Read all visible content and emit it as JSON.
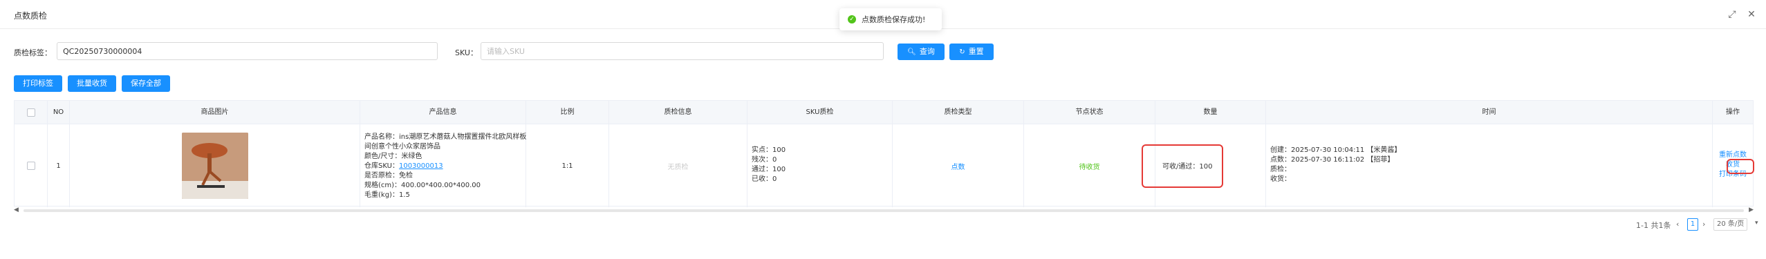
{
  "header": {
    "title": "点数质检"
  },
  "toast": {
    "message": "点数质检保存成功!"
  },
  "filters": {
    "tag_label": "质检标签：",
    "tag_value": "QC20250730000004",
    "sku_label": "SKU：",
    "sku_placeholder": "请输入SKU",
    "search_label": "查询",
    "reset_label": "重置"
  },
  "actions": {
    "print_label": "打印标签",
    "batch_receive": "批量收货",
    "save_all": "保存全部"
  },
  "table": {
    "headers": [
      "NO",
      "商品图片",
      "产品信息",
      "比例",
      "质检信息",
      "SKU质检",
      "质检类型",
      "节点状态",
      "数量",
      "时间",
      "操作"
    ],
    "row": {
      "no": "1",
      "product_info": {
        "name_line1": "产品名称：ins潮原艺术蘑菇人物摆置摆件北欧风样板",
        "name_line2": "间创意个性小众家居饰品",
        "color": "颜色/尺寸：米绿色",
        "sku_label": "仓库SKU：",
        "sku_link": "1003000013",
        "sourcing": "是否原检：免检",
        "size": "规格(cm)：400.00*400.00*400.00",
        "weight": "毛重(kg)：1.5"
      },
      "ratio": "1:1",
      "qc_info": "无质检",
      "sku_qc": {
        "actual": "实点：100",
        "defect": "残次：0",
        "pass": "通过：100",
        "received": "已收：0"
      },
      "qc_type": "点数",
      "node_status": "待收货",
      "quantity": "可收/通过：100",
      "time": {
        "created": "创建：2025-07-30 10:04:11 【米黄酱】",
        "counted": "点数：2025-07-30 16:11:02 【招菲】",
        "qc": "质检：",
        "received": "收货："
      },
      "ops": {
        "recount": "重新点数",
        "receive": "收货",
        "print_barcode": "打印条码"
      }
    }
  },
  "pagination": {
    "summary": "1-1 共1条",
    "current_page": "1",
    "page_size": "20 条/页"
  },
  "colors": {
    "primary": "#1890ff",
    "success": "#52c41a",
    "highlight": "#e53935"
  }
}
